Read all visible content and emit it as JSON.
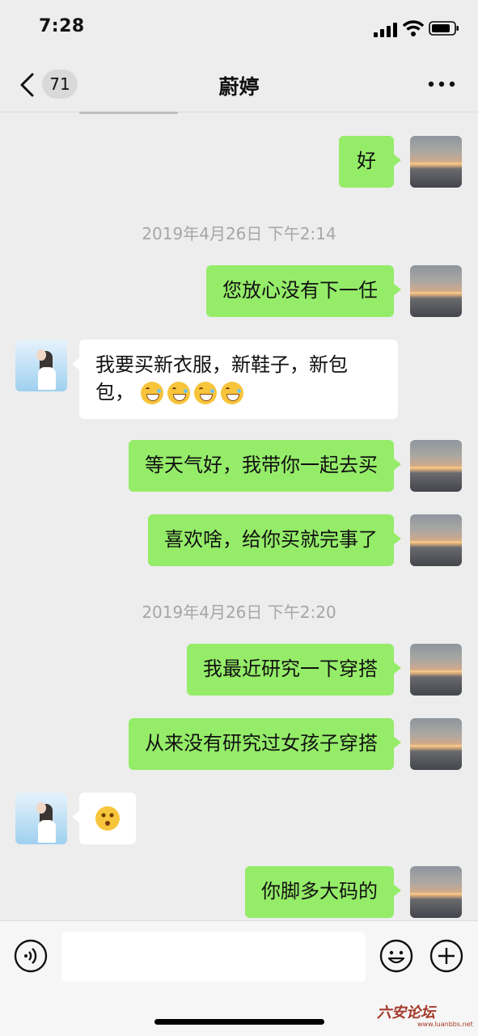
{
  "status_bar": {
    "time": "7:28"
  },
  "nav": {
    "back_count": "71",
    "title": "蔚婷"
  },
  "messages": {
    "m1": "好",
    "t1": "2019年4月26日 下午2:14",
    "m2": "您放心没有下一任",
    "m3": "我要买新衣服，新鞋子，新包包，",
    "m3_emoji_count": 4,
    "m4": "等天气好，我带你一起去买",
    "m5": "喜欢啥，给你买就完事了",
    "t2": "2019年4月26日 下午2:20",
    "m6": "我最近研究一下穿搭",
    "m7": "从来没有研究过女孩子穿搭",
    "m8_emoji": "surprised-face",
    "m9": "你脚多大码的"
  },
  "input_bar": {
    "value": "",
    "placeholder": ""
  },
  "icons": [
    "back-icon",
    "more-icon",
    "voice-icon",
    "emoji-icon",
    "add-icon",
    "signal-icon",
    "wifi-icon",
    "battery-icon"
  ],
  "colors": {
    "my_bubble": "#95ec69",
    "their_bubble": "#ffffff",
    "background": "#ededed"
  },
  "watermark": "六安论坛",
  "watermark_sub": "www.luanbbs.net"
}
